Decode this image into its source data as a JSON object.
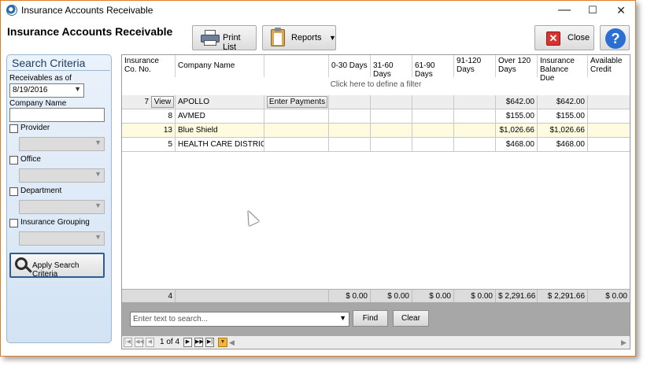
{
  "window": {
    "title": "Insurance Accounts Receivable",
    "controls": {
      "minimize": "—",
      "maximize": "☐",
      "close": "✕"
    }
  },
  "header": {
    "title": "Insurance Accounts Receivable",
    "print_list": "Print List",
    "reports": "Reports",
    "close": "Close",
    "help": "?"
  },
  "search_criteria": {
    "title": "Search Criteria",
    "receivables_label": "Receivables as of",
    "receivables_value": "8/19/2016",
    "company_name_label": "Company Name",
    "company_name_value": "",
    "filters": [
      {
        "label": "Provider",
        "checked": false
      },
      {
        "label": "Office",
        "checked": false
      },
      {
        "label": "Department",
        "checked": false
      },
      {
        "label": "Insurance Grouping",
        "checked": false
      }
    ],
    "apply_button": "Apply Search Criteria"
  },
  "grid": {
    "columns": [
      "Insurance Co. No.",
      "Company Name",
      "",
      "0-30 Days",
      "31-60 Days",
      "61-90 Days",
      "91-120 Days",
      "Over 120 Days",
      "Insurance Balance Due",
      "Available Credit"
    ],
    "filter_hint": "Click here to define a filter",
    "view_label": "View",
    "enter_payments_label": "Enter Payments",
    "rows": [
      {
        "no": "7",
        "company": "APOLLO",
        "d0_30": "",
        "d31_60": "",
        "d61_90": "",
        "d91_120": "",
        "over120": "$642.00",
        "balance": "$642.00",
        "credit": ""
      },
      {
        "no": "8",
        "company": "AVMED",
        "d0_30": "",
        "d31_60": "",
        "d61_90": "",
        "d91_120": "",
        "over120": "$155.00",
        "balance": "$155.00",
        "credit": ""
      },
      {
        "no": "13",
        "company": "Blue Shield",
        "d0_30": "",
        "d31_60": "",
        "d61_90": "",
        "d91_120": "",
        "over120": "$1,026.66",
        "balance": "$1,026.66",
        "credit": ""
      },
      {
        "no": "5",
        "company": "HEALTH CARE DISTRICT",
        "d0_30": "",
        "d31_60": "",
        "d61_90": "",
        "d91_120": "",
        "over120": "$468.00",
        "balance": "$468.00",
        "credit": ""
      }
    ],
    "totals": {
      "count": "4",
      "d0_30": "$ 0.00",
      "d31_60": "$ 0.00",
      "d61_90": "$ 0.00",
      "d91_120": "$ 0.00",
      "over120": "$ 2,291.66",
      "balance": "$ 2,291.66",
      "credit": "$ 0.00"
    }
  },
  "search_bar": {
    "placeholder": "Enter text to search...",
    "find": "Find",
    "clear": "Clear"
  },
  "pager": {
    "page_text": "1 of 4"
  },
  "colors": {
    "selected_row": "#fffbe0",
    "first_row": "#eeeeee",
    "accent_border": "#e07b2a"
  }
}
